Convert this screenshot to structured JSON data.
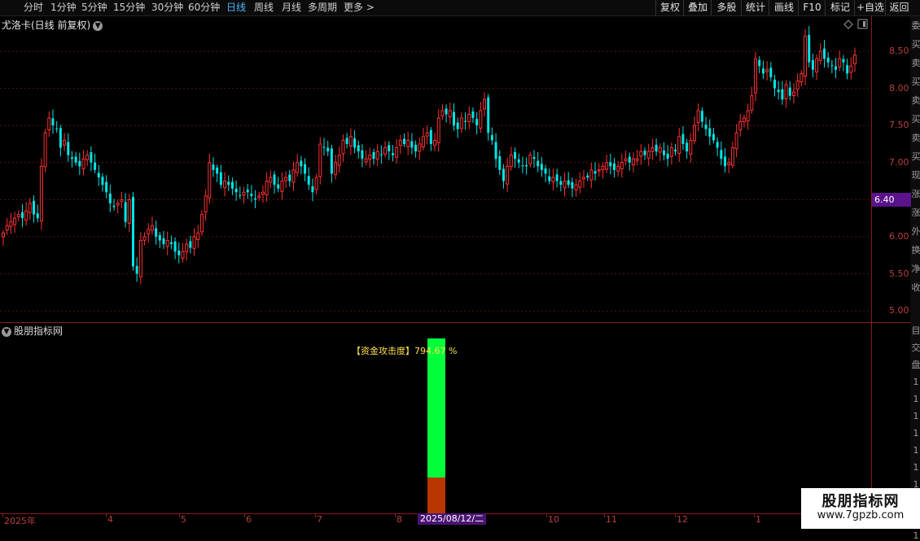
{
  "toolbar": {
    "periods": [
      {
        "label": "分时",
        "active": false
      },
      {
        "label": "1分钟",
        "active": false
      },
      {
        "label": "5分钟",
        "active": false
      },
      {
        "label": "15分钟",
        "active": false
      },
      {
        "label": "30分钟",
        "active": false
      },
      {
        "label": "60分钟",
        "active": false
      },
      {
        "label": "日线",
        "active": true
      },
      {
        "label": "周线",
        "active": false
      },
      {
        "label": "月线",
        "active": false
      },
      {
        "label": "多周期",
        "active": false
      },
      {
        "label": "更多 >",
        "active": false
      }
    ],
    "buttons": [
      "复权",
      "叠加",
      "多股",
      "统计",
      "画线",
      "F10",
      "标记",
      "+自选",
      "返回"
    ]
  },
  "chart": {
    "title": "尤洛卡(日线 前复权)",
    "yticks": [
      "8.50",
      "8.00",
      "7.50",
      "7.00",
      "6.50",
      "6.00",
      "5.50",
      "5.00"
    ],
    "price_tag": "6.40",
    "side_chars": [
      "委",
      "买",
      "卖",
      "买",
      "卖",
      "买",
      "卖",
      "买",
      "现",
      "涨",
      "涨",
      "外",
      "换",
      "净",
      "收"
    ],
    "side_chars_lower": [
      "目",
      "交",
      "盘",
      "1",
      "1",
      "1",
      "1",
      "1",
      "1",
      "1",
      "1",
      "1",
      "1"
    ]
  },
  "indicator_panel": {
    "title": "股朋指标网",
    "label": "【资金攻击度】794.67 %"
  },
  "x_axis": {
    "labels": [
      "2025年",
      "4",
      "5",
      "6",
      "7",
      "8",
      "10",
      "11",
      "12",
      "1"
    ],
    "cursor_date": "2025/08/12/二"
  },
  "watermark": {
    "name": "股朋指标网",
    "url": "www.7gpzb.com"
  },
  "colors": {
    "up": "#ff3030",
    "down": "#00e5e5",
    "grid": "#5a1010",
    "bar_green": "#00ff3a",
    "bar_red": "#b83600",
    "accent_active": "#4fb4ff"
  },
  "chart_data": {
    "type": "candlestick",
    "title": "尤洛卡(日线 前复权)",
    "ylim": [
      4.85,
      8.85
    ],
    "close": [
      6.05,
      6.15,
      6.2,
      6.25,
      6.3,
      6.25,
      6.35,
      6.45,
      6.3,
      6.25,
      6.95,
      7.4,
      7.6,
      7.5,
      7.45,
      7.2,
      7.3,
      7.1,
      7.05,
      7.0,
      6.95,
      7.05,
      7.1,
      7.0,
      6.9,
      6.8,
      6.7,
      6.6,
      6.45,
      6.4,
      6.45,
      6.5,
      6.2,
      6.5,
      5.6,
      5.5,
      5.95,
      6.0,
      6.1,
      6.15,
      6.0,
      5.95,
      5.9,
      5.95,
      5.9,
      5.8,
      5.75,
      5.8,
      5.9,
      5.85,
      6.0,
      6.05,
      6.3,
      6.55,
      7.0,
      6.9,
      6.85,
      6.7,
      6.75,
      6.7,
      6.65,
      6.6,
      6.55,
      6.6,
      6.6,
      6.55,
      6.5,
      6.55,
      6.6,
      6.75,
      6.8,
      6.7,
      6.65,
      6.75,
      6.8,
      6.75,
      6.9,
      7.0,
      6.95,
      6.85,
      6.7,
      6.6,
      6.8,
      7.25,
      7.2,
      7.15,
      6.85,
      7.0,
      7.1,
      7.3,
      7.25,
      7.35,
      7.2,
      7.15,
      7.05,
      7.05,
      7.1,
      7.05,
      7.15,
      7.1,
      7.2,
      7.15,
      7.1,
      7.2,
      7.3,
      7.25,
      7.3,
      7.2,
      7.15,
      7.25,
      7.35,
      7.4,
      7.25,
      7.3,
      7.6,
      7.7,
      7.65,
      7.7,
      7.5,
      7.45,
      7.6,
      7.55,
      7.65,
      7.6,
      7.5,
      7.7,
      7.85,
      7.4,
      7.3,
      7.05,
      6.9,
      6.75,
      6.95,
      7.1,
      7.05,
      7.0,
      6.95,
      6.95,
      7.1,
      7.05,
      6.95,
      6.9,
      6.85,
      6.75,
      6.8,
      6.75,
      6.7,
      6.75,
      6.7,
      6.65,
      6.7,
      6.75,
      6.8,
      6.8,
      6.9,
      6.85,
      6.9,
      6.95,
      7.0,
      6.95,
      6.9,
      6.95,
      7.0,
      7.05,
      7.0,
      7.05,
      7.05,
      7.15,
      7.1,
      7.15,
      7.2,
      7.15,
      7.2,
      7.1,
      7.05,
      7.2,
      7.15,
      7.35,
      7.25,
      7.15,
      7.3,
      7.5,
      7.7,
      7.55,
      7.45,
      7.35,
      7.3,
      7.2,
      7.05,
      6.95,
      7.0,
      7.2,
      7.4,
      7.55,
      7.6,
      7.7,
      7.9,
      8.4,
      8.3,
      8.2,
      8.25,
      8.15,
      8.0,
      7.95,
      7.85,
      8.05,
      7.9,
      7.95,
      8.1,
      8.2,
      8.7,
      8.35,
      8.25,
      8.4,
      8.5,
      8.4,
      8.35,
      8.3,
      8.25,
      8.4,
      8.35,
      8.2,
      8.3,
      8.45
    ]
  }
}
